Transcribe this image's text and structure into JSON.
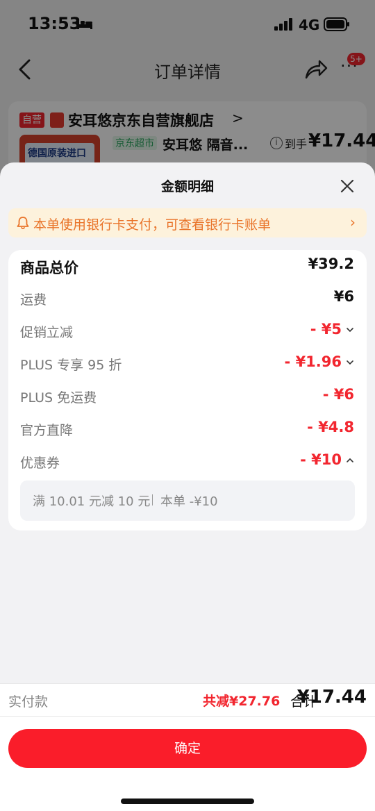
{
  "status_bar": {
    "time": "13:53",
    "network": "4G",
    "icons": [
      "bed-icon",
      "signal-icon",
      "battery-icon"
    ]
  },
  "nav": {
    "title": "订单详情",
    "badge": "5+",
    "icons": [
      "back-icon",
      "share-icon",
      "more-icon"
    ]
  },
  "store": {
    "self_tag": "自营",
    "name": "安耳悠京东自营旗舰店",
    "arrow": ">",
    "thumb_text": "德国原装进口",
    "category_tag": "京东超市",
    "product_name": "安耳悠 隔音...",
    "to_hand_label": "到手",
    "to_hand_price": "¥17.44"
  },
  "sheet": {
    "title": "金额明细",
    "notice": "本单使用银行卡支付，可查看银行卡账单",
    "notice_arrow": "›",
    "rows": [
      {
        "label": "商品总价",
        "value": "¥39.2"
      },
      {
        "label": "运费",
        "value": "¥6"
      },
      {
        "label": "促销立减",
        "value": "- ¥5"
      },
      {
        "label": "PLUS 专享 95 折",
        "value": "- ¥1.96"
      },
      {
        "label": "PLUS 免运费",
        "value": "- ¥6"
      },
      {
        "label": "官方直降",
        "value": "- ¥4.8"
      },
      {
        "label": "优惠券",
        "value": "- ¥10"
      }
    ],
    "coupon": {
      "text": "满 10.01 元减 10 元",
      "this_order": "本单 -¥10"
    }
  },
  "summary": {
    "paid_label": "实付款",
    "saved": "共减¥27.76",
    "total_label": "合计",
    "total_value": "¥17.44"
  },
  "footer": {
    "confirm_label": "确定"
  },
  "colors": {
    "accent_red": "#f2262f",
    "notice_orange": "#e9742a",
    "notice_bg": "#fdf2dc"
  }
}
